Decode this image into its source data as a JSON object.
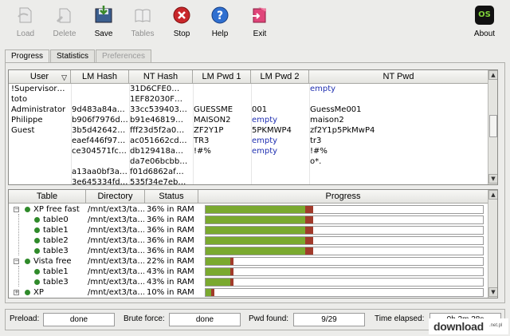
{
  "toolbar": {
    "load": "Load",
    "delete": "Delete",
    "save": "Save",
    "tables": "Tables",
    "stop": "Stop",
    "help": "Help",
    "exit": "Exit",
    "about": "About",
    "about_logo": "OS"
  },
  "tabs": [
    "Progress",
    "Statistics",
    "Preferences"
  ],
  "hash_table": {
    "columns": [
      "User",
      "LM Hash",
      "NT Hash",
      "LM Pwd 1",
      "LM Pwd 2",
      "NT Pwd"
    ],
    "rows": [
      [
        "!Supervisor…",
        "",
        "31D6CFE0…",
        "",
        "",
        "empty"
      ],
      [
        "toto",
        "",
        "1EF82030F…",
        "",
        "",
        ""
      ],
      [
        "Administrator",
        "9d483a84a…",
        "33cc539403…",
        "GUESSME",
        "001",
        "GuessMe001"
      ],
      [
        "Philippe",
        "b906f7976d…",
        "b91e46819…",
        "MAISON2",
        "empty",
        "maison2"
      ],
      [
        "Guest",
        "3b5d42642…",
        "fff23d5f2a0…",
        "ZF2Y1P",
        "5PKMWP4",
        "zf2Y1p5PkMwP4"
      ],
      [
        "",
        "eaef446f97…",
        "ac051662cd…",
        "TR3",
        "empty",
        "tr3"
      ],
      [
        "",
        "ce304571fc…",
        "db129418a…",
        "!#%",
        "empty",
        "!#%"
      ],
      [
        "",
        "",
        "da7e06bcbb…",
        "",
        "",
        "o*."
      ],
      [
        "",
        "a13aa0bf3a…",
        "f01d6862af…",
        "",
        "",
        ""
      ],
      [
        "",
        "3e645334fd…",
        "535f34e7eb…",
        "",
        "",
        ""
      ]
    ]
  },
  "progress_table": {
    "columns": [
      "Table",
      "Directory",
      "Status",
      "Progress"
    ],
    "rows": [
      {
        "name": "XP free fast",
        "dir": "/mnt/ext3/ta…",
        "status": "36% in RAM",
        "progress": 0.36,
        "level": 0,
        "expanded": true
      },
      {
        "name": "table0",
        "dir": "/mnt/ext3/ta…",
        "status": "36% in RAM",
        "progress": 0.36,
        "level": 1
      },
      {
        "name": "table1",
        "dir": "/mnt/ext3/ta…",
        "status": "36% in RAM",
        "progress": 0.36,
        "level": 1
      },
      {
        "name": "table2",
        "dir": "/mnt/ext3/ta…",
        "status": "36% in RAM",
        "progress": 0.36,
        "level": 1
      },
      {
        "name": "table3",
        "dir": "/mnt/ext3/ta…",
        "status": "36% in RAM",
        "progress": 0.36,
        "level": 1
      },
      {
        "name": "Vista free",
        "dir": "/mnt/ext3/ta…",
        "status": "22% in RAM",
        "progress": 0.09,
        "level": 0,
        "expanded": true
      },
      {
        "name": "table1",
        "dir": "/mnt/ext3/ta…",
        "status": "43% in RAM",
        "progress": 0.09,
        "level": 1
      },
      {
        "name": "table3",
        "dir": "/mnt/ext3/ta…",
        "status": "43% in RAM",
        "progress": 0.09,
        "level": 1
      },
      {
        "name": "XP",
        "dir": "/mnt/ext3/ta…",
        "status": "10% in RAM",
        "progress": 0.02,
        "level": 0,
        "expanded": false
      }
    ]
  },
  "status_bar": {
    "preload_label": "Preload:",
    "preload_value": "done",
    "brute_label": "Brute force:",
    "brute_value": "done",
    "pwd_label": "Pwd found:",
    "pwd_value": "9/29",
    "time_label": "Time elapsed:",
    "time_value": "0h 2m 38s"
  },
  "watermark": {
    "text": "download",
    "tld": ".net.pl"
  },
  "colors": {
    "progress_green": "#7aa92f",
    "progress_red": "#a13b2b",
    "cracked_blue": "#1f2fb0",
    "tree_bullet": "#2f8a2a"
  }
}
